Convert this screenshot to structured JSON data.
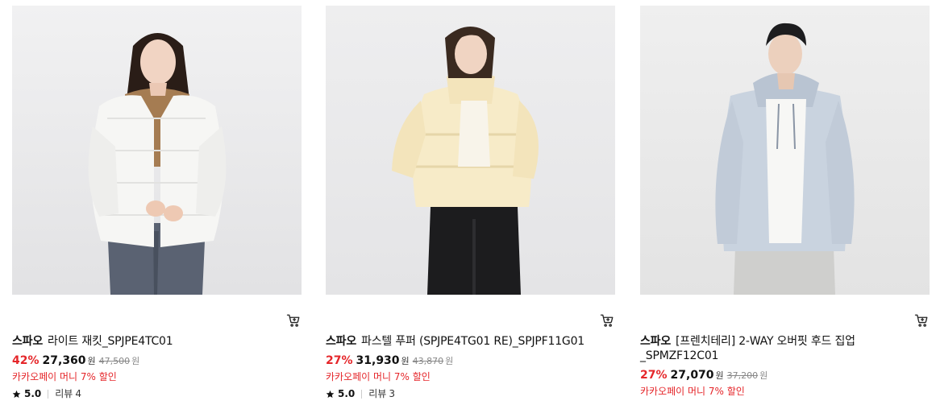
{
  "products": [
    {
      "brand": "스파오",
      "name": "라이트 재킷_SPJPE4TC01",
      "discount": "42%",
      "price": "27,360",
      "currency": "원",
      "original_price": "47,500",
      "promo": "카카오페이 머니 7% 할인",
      "rating": "5.0",
      "review_label": "리뷰",
      "review_count": "4",
      "image": "woman-white-jacket"
    },
    {
      "brand": "스파오",
      "name": "파스텔 푸퍼 (SPJPE4TG01 RE)_SPJPF11G01",
      "discount": "27%",
      "price": "31,930",
      "currency": "원",
      "original_price": "43,870",
      "promo": "카카오페이 머니 7% 할인",
      "rating": "5.0",
      "review_label": "리뷰",
      "review_count": "3",
      "image": "woman-cream-puffer"
    },
    {
      "brand": "스파오",
      "name": "[프렌치테리] 2-WAY 오버핏 후드 집업 _SPMZF12C01",
      "discount": "27%",
      "price": "27,070",
      "currency": "원",
      "original_price": "37,200",
      "promo": "카카오페이 머니 7% 할인",
      "image": "man-blue-hoodie"
    }
  ],
  "icons": {
    "cart": "cart-icon",
    "star": "star-icon"
  },
  "colors": {
    "discount": "#e5262a",
    "promo": "#e5262a"
  }
}
